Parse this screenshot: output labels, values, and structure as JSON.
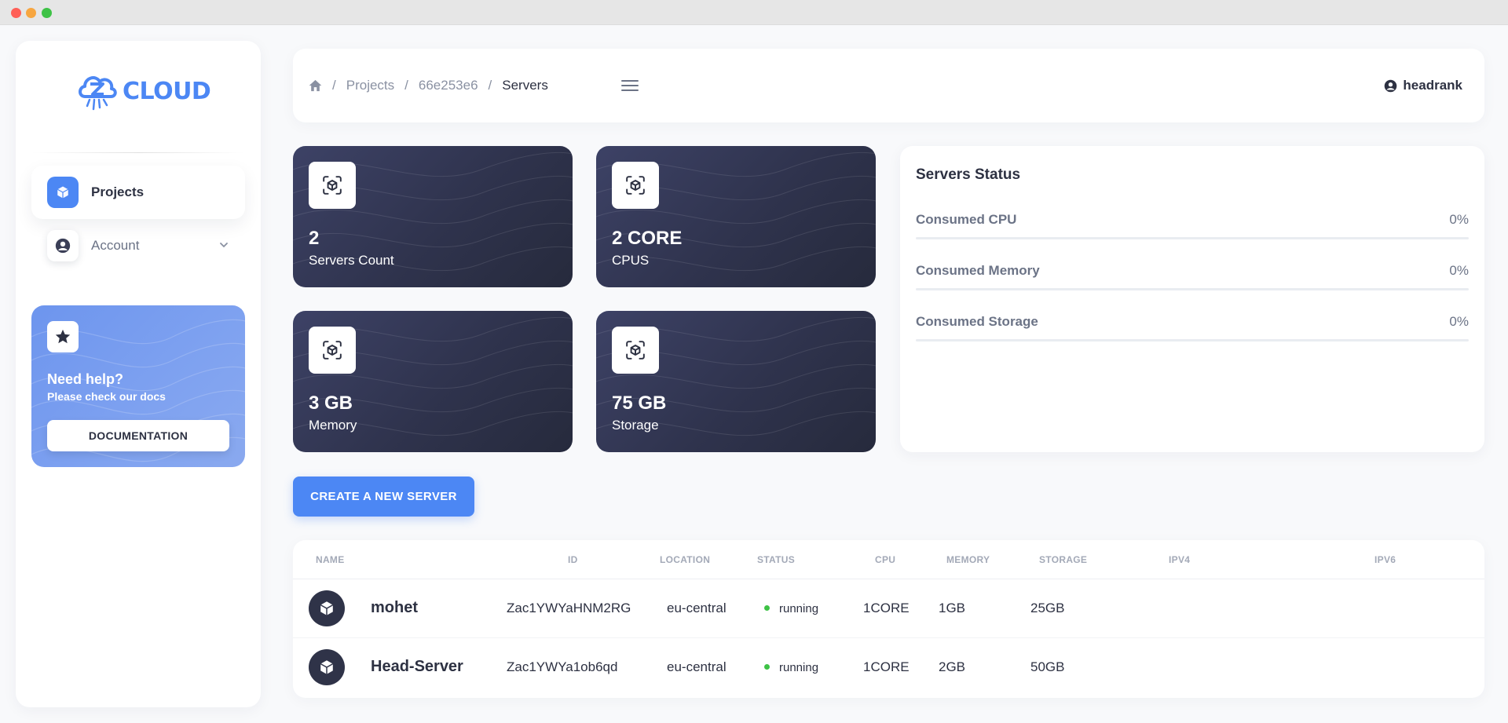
{
  "colors": {
    "accent": "#4c87f4",
    "dark_card": "#2f334d",
    "running": "#3ec246"
  },
  "sidebar": {
    "logo_text": "CLOUD",
    "logo_mark": "ZA",
    "items": [
      {
        "label": "Projects",
        "icon": "cube-icon",
        "active": true
      },
      {
        "label": "Account",
        "icon": "user-circle-icon",
        "active": false
      }
    ],
    "help": {
      "title": "Need help?",
      "subtitle": "Please check our docs",
      "button": "DOCUMENTATION"
    }
  },
  "header": {
    "breadcrumb": [
      "Projects",
      "66e253e6"
    ],
    "current": "Servers",
    "user": "headrank"
  },
  "stats": [
    {
      "value": "2",
      "label": "Servers Count"
    },
    {
      "value": "2 CORE",
      "label": "CPUS"
    },
    {
      "value": "3 GB",
      "label": "Memory"
    },
    {
      "value": "75 GB",
      "label": "Storage"
    }
  ],
  "servers_status": {
    "title": "Servers Status",
    "metrics": [
      {
        "name": "Consumed CPU",
        "value": "0%",
        "fraction": 0
      },
      {
        "name": "Consumed Memory",
        "value": "0%",
        "fraction": 0
      },
      {
        "name": "Consumed Storage",
        "value": "0%",
        "fraction": 0
      }
    ]
  },
  "create_button": "CREATE A NEW SERVER",
  "table": {
    "headers": [
      "NAME",
      "ID",
      "LOCATION",
      "STATUS",
      "CPU",
      "MEMORY",
      "STORAGE",
      "IPV4",
      "IPV6"
    ],
    "rows": [
      {
        "name": "mohet",
        "id": "Zac1YWYaHNM2RG",
        "location": "eu-central",
        "status": "running",
        "cpu": "1CORE",
        "memory": "1GB",
        "storage": "25GB",
        "ipv4": "",
        "ipv6": ""
      },
      {
        "name": "Head-Server",
        "id": "Zac1YWYa1ob6qd",
        "location": "eu-central",
        "status": "running",
        "cpu": "1CORE",
        "memory": "2GB",
        "storage": "50GB",
        "ipv4": "",
        "ipv6": ""
      }
    ]
  }
}
